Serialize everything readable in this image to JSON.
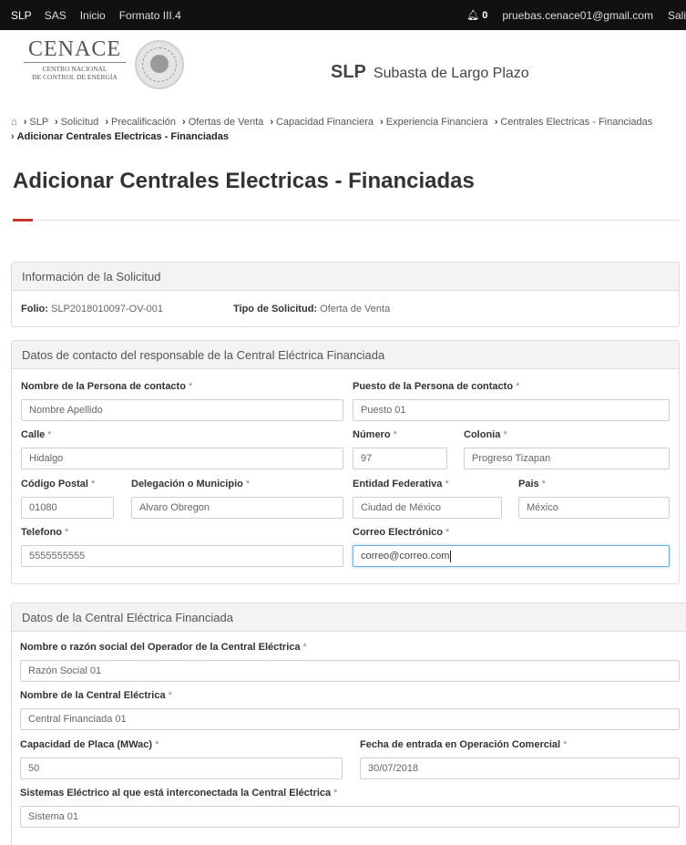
{
  "topbar": {
    "brand": "SLP",
    "nav": [
      "SAS",
      "Inicio",
      "Formato III.4"
    ],
    "notifications": "0",
    "email": "pruebas.cenace01@gmail.com",
    "logout": "Sali"
  },
  "header": {
    "logo_main": "CENACE",
    "logo_sub_1": "CENTRO NACIONAL",
    "logo_sub_2": "DE CONTROL DE ENERGÍA",
    "system_code": "SLP",
    "system_name": "Subasta de Largo Plazo"
  },
  "breadcrumb": [
    "SLP",
    "Solicitud",
    "Precalificación",
    "Ofertas de Venta",
    "Capacidad Financiera",
    "Experiencia Financiera",
    "Centrales Electricas - Financiadas"
  ],
  "breadcrumb_current": "Adicionar Centrales Electricas - Financiadas",
  "page_title": "Adicionar Centrales Electricas - Financiadas",
  "info_panel": {
    "title": "Información de la Solicitud",
    "folio_label": "Folio:",
    "folio_value": "SLP2018010097-OV-001",
    "tipo_label": "Tipo de Solicitud:",
    "tipo_value": "Oferta de Venta"
  },
  "contact_panel": {
    "title": "Datos de contacto del responsable de la Central Eléctrica Financiada",
    "nombre_label": "Nombre de la Persona de contacto",
    "nombre_value": "Nombre Apellido",
    "puesto_label": "Puesto de la Persona de contacto",
    "puesto_value": "Puesto 01",
    "calle_label": "Calle",
    "calle_value": "Hidalgo",
    "numero_label": "Número",
    "numero_value": "97",
    "colonia_label": "Colonia",
    "colonia_value": "Progreso Tizapan",
    "cp_label": "Código Postal",
    "cp_value": "01080",
    "delegacion_label": "Delegación o Municipio",
    "delegacion_value": "Alvaro Obregon",
    "entidad_label": "Entidad Federativa",
    "entidad_value": "Ciudad de México",
    "pais_label": "Pais",
    "pais_value": "México",
    "telefono_label": "Telefono",
    "telefono_value": "5555555555",
    "correo_label": "Correo Electrónico",
    "correo_value": "correo@correo.com"
  },
  "central_panel": {
    "title": "Datos de la Central Eléctrica Financiada",
    "operador_label": "Nombre o razón social del Operador de la Central Eléctrica",
    "operador_value": "Razón Social 01",
    "central_label": "Nombre de la Central Eléctrica",
    "central_value": "Central Financiada 01",
    "capacidad_label": "Capacidad de Placa (MWac)",
    "capacidad_value": "50",
    "fecha_label": "Fecha de entrada en Operación Comercial",
    "fecha_value": "30/07/2018",
    "sistema_label": "Sistemas Eléctrico al que está interconectada la Central Eléctrica",
    "sistema_value": "Sistema 01"
  },
  "required_mark": "*",
  "icons": {
    "home": "home-icon",
    "bell": "bell-icon"
  },
  "colors": {
    "topbar": "#111111",
    "accent": "#c0392b",
    "focus": "#66afe9"
  }
}
